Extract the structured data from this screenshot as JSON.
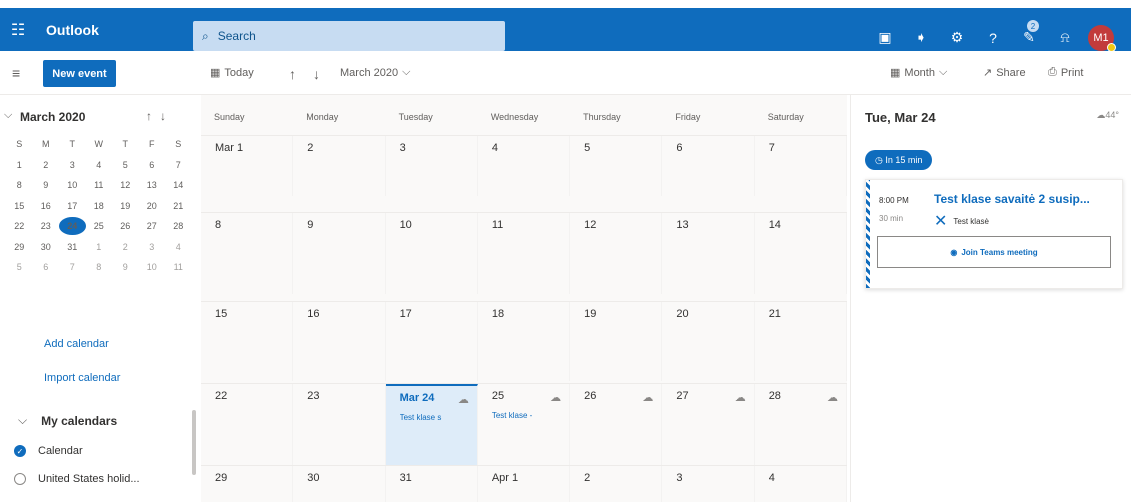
{
  "app": {
    "name": "Outlook"
  },
  "search": {
    "placeholder": "Search"
  },
  "topbar": {
    "badge_count": "2",
    "avatar_initials": "M1"
  },
  "toolbar": {
    "new_event": "New event",
    "today": "Today",
    "period": "March 2020",
    "view": "Month",
    "share": "Share",
    "print": "Print"
  },
  "mini_calendar": {
    "month": "March 2020",
    "weekdays": [
      "S",
      "M",
      "T",
      "W",
      "T",
      "F",
      "S"
    ],
    "weeks": [
      [
        "1",
        "2",
        "3",
        "4",
        "5",
        "6",
        "7"
      ],
      [
        "8",
        "9",
        "10",
        "11",
        "12",
        "13",
        "14"
      ],
      [
        "15",
        "16",
        "17",
        "18",
        "19",
        "20",
        "21"
      ],
      [
        "22",
        "23",
        "24",
        "25",
        "26",
        "27",
        "28"
      ],
      [
        "29",
        "30",
        "31",
        "1",
        "2",
        "3",
        "4"
      ],
      [
        "5",
        "6",
        "7",
        "8",
        "9",
        "10",
        "11"
      ]
    ],
    "selected": "24"
  },
  "sidebar": {
    "add_calendar": "Add calendar",
    "import_calendar": "Import calendar",
    "my_calendars": "My calendars",
    "calendars": [
      "Calendar",
      "United States holid..."
    ]
  },
  "calendar": {
    "day_headers": [
      "Sunday",
      "Monday",
      "Tuesday",
      "Wednesday",
      "Thursday",
      "Friday",
      "Saturday"
    ],
    "weeks": [
      [
        "Mar 1",
        "2",
        "3",
        "4",
        "5",
        "6",
        "7"
      ],
      [
        "8",
        "9",
        "10",
        "11",
        "12",
        "13",
        "14"
      ],
      [
        "15",
        "16",
        "17",
        "18",
        "19",
        "20",
        "21"
      ],
      [
        "22",
        "23",
        "Mar 24",
        "25",
        "26",
        "27",
        "28"
      ],
      [
        "29",
        "30",
        "31",
        "Apr 1",
        "2",
        "3",
        "4"
      ]
    ],
    "events": {
      "tue": "Test klase s",
      "wed": "Test klase -"
    }
  },
  "agenda": {
    "date": "Tue, Mar 24",
    "weather": "44°",
    "in_time": "In 15 min",
    "event": {
      "time": "8:00 PM",
      "duration": "30 min",
      "title": "Test klase savaitė 2 susip...",
      "location": "Test klasė",
      "join": "Join Teams meeting"
    }
  },
  "colors": {
    "accent": "#0f6cbd",
    "today_bg": "#deecf9"
  }
}
